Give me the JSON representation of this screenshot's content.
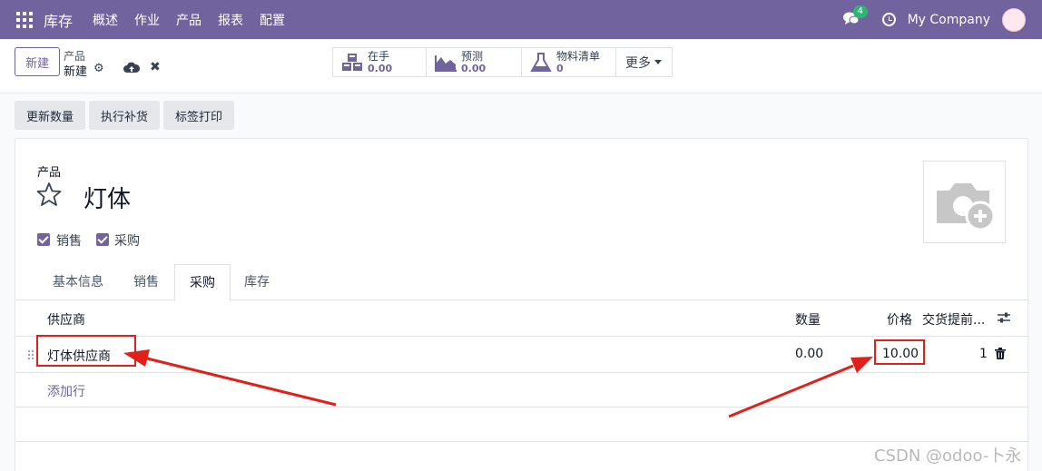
{
  "navbar": {
    "brand": "库存",
    "menu": [
      "概述",
      "作业",
      "产品",
      "报表",
      "配置"
    ],
    "chat_badge": "4",
    "company": "My Company"
  },
  "control": {
    "new_label": "新建",
    "breadcrumb_parent": "产品",
    "breadcrumb_current": "新建",
    "stats": [
      {
        "label": "在手",
        "value": "0.00",
        "icon": "cubes-icon"
      },
      {
        "label": "预测",
        "value": "0.00",
        "icon": "area-chart-icon"
      },
      {
        "label": "物料清单",
        "value": "0",
        "icon": "flask-icon"
      }
    ],
    "more_label": "更多"
  },
  "actions": [
    "更新数量",
    "执行补货",
    "标签打印"
  ],
  "form": {
    "label": "产品",
    "product_name": "灯体",
    "checkboxes": [
      {
        "label": "销售",
        "checked": true
      },
      {
        "label": "采购",
        "checked": true
      }
    ],
    "tabs": [
      "基本信息",
      "销售",
      "采购",
      "库存"
    ],
    "active_tab": "采购",
    "columns": {
      "vendor": "供应商",
      "qty": "数量",
      "price": "价格",
      "lead": "交货提前..."
    },
    "rows": [
      {
        "vendor": "灯体供应商",
        "qty": "0.00",
        "price": "10.00",
        "lead": "1"
      }
    ],
    "add_line": "添加行"
  },
  "colors": {
    "brand": "#71639e",
    "annotation": "#e0211b"
  },
  "watermark": "CSDN @odoo-卜永"
}
